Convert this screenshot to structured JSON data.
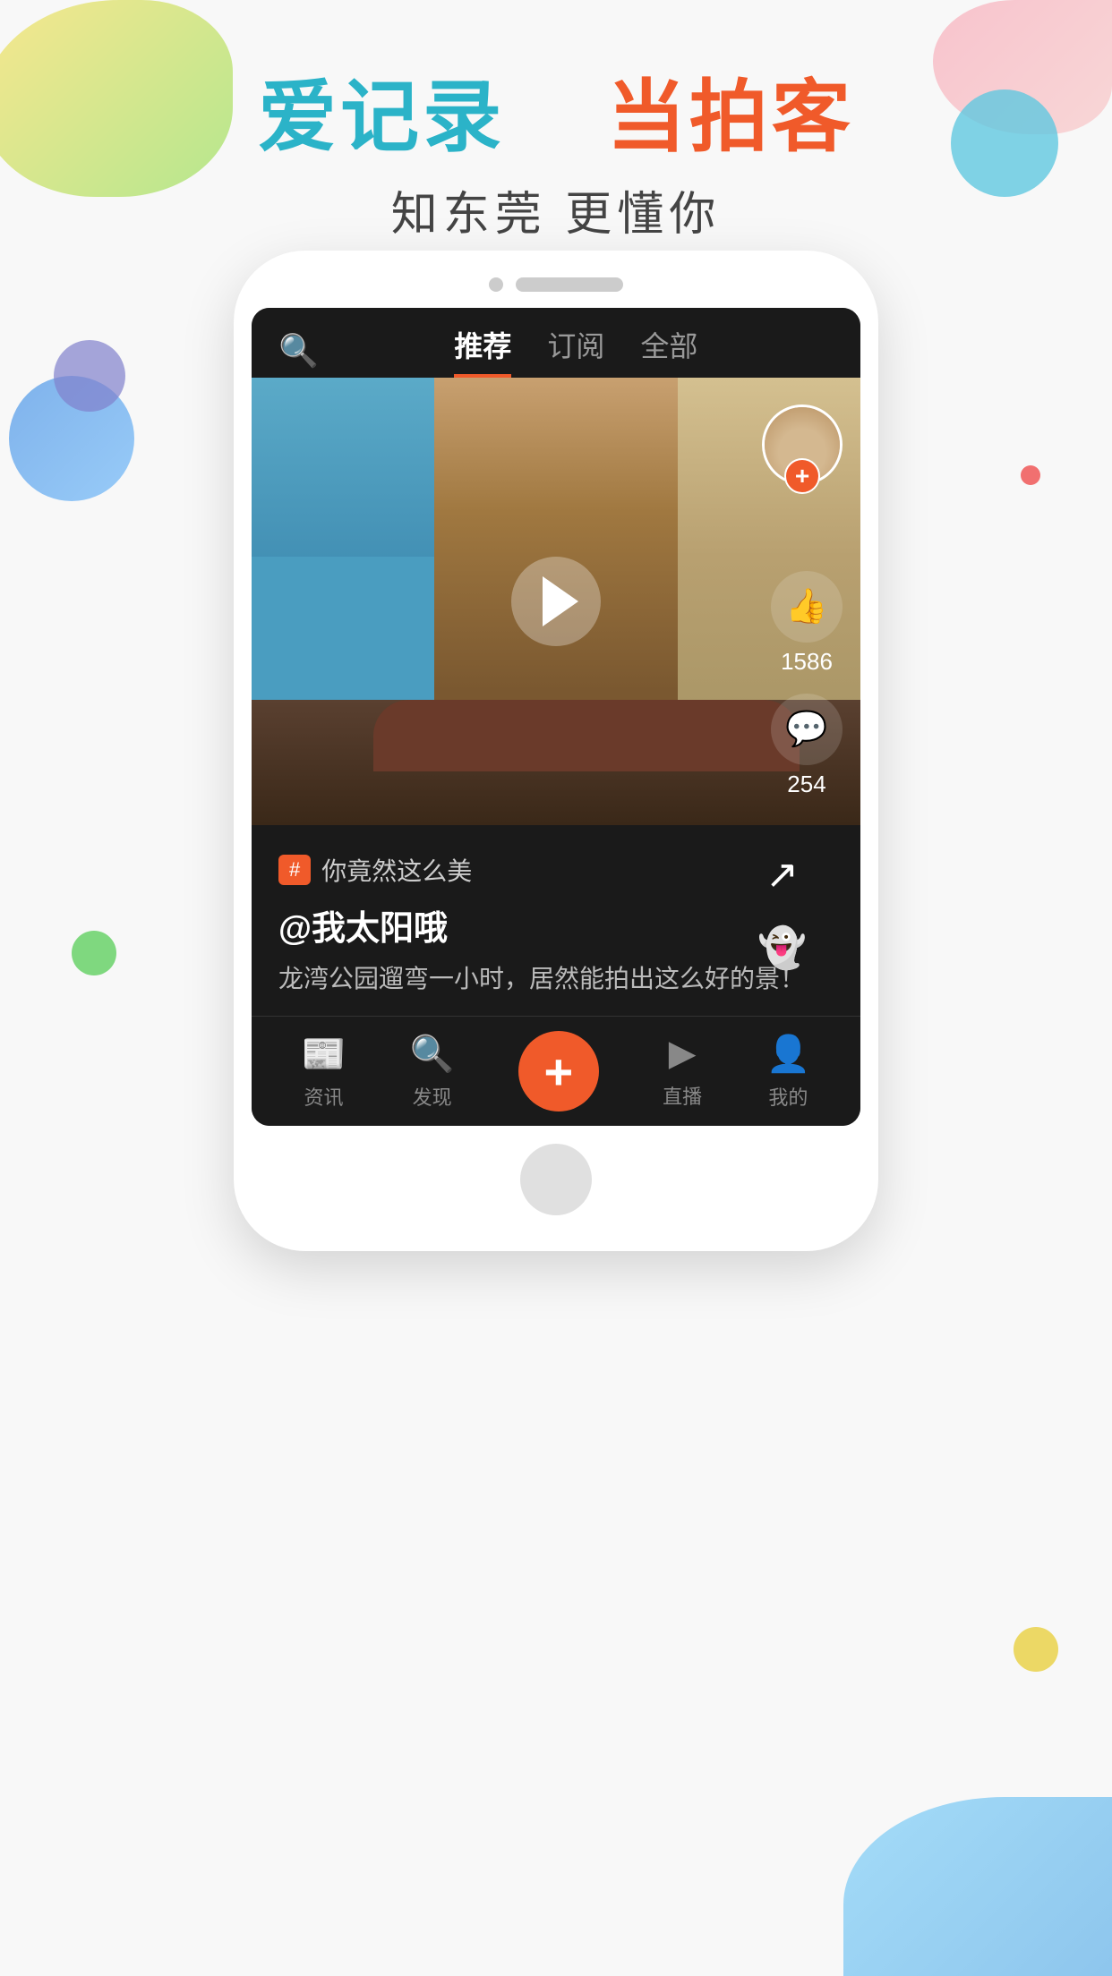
{
  "headline": {
    "part1": "爱记录",
    "part2": "当拍客"
  },
  "subtitle": "知东莞 更懂你",
  "nav": {
    "tabs": [
      {
        "id": "recommended",
        "label": "推荐",
        "active": true
      },
      {
        "id": "subscription",
        "label": "订阅",
        "active": false
      },
      {
        "id": "all",
        "label": "全部",
        "active": false
      }
    ],
    "search_icon": "🔍"
  },
  "video": {
    "likes": "1586",
    "comments": "254"
  },
  "post": {
    "tag": "#",
    "tag_text": "你竟然这么美",
    "author": "@我太阳哦",
    "description": "龙湾公园遛弯一小时，居然能拍出这么好的景！"
  },
  "bottom_nav": {
    "items": [
      {
        "id": "news",
        "label": "资讯",
        "icon": "📰"
      },
      {
        "id": "discover",
        "label": "发现",
        "icon": "🔍"
      },
      {
        "id": "add",
        "label": "+",
        "is_plus": true
      },
      {
        "id": "live",
        "label": "直播",
        "icon": "▶"
      },
      {
        "id": "mine",
        "label": "我的",
        "icon": "👤"
      }
    ]
  },
  "icons": {
    "share": "↗",
    "ghost": "👻",
    "like": "👍",
    "comment": "💬",
    "play": "▶",
    "plus": "+"
  }
}
